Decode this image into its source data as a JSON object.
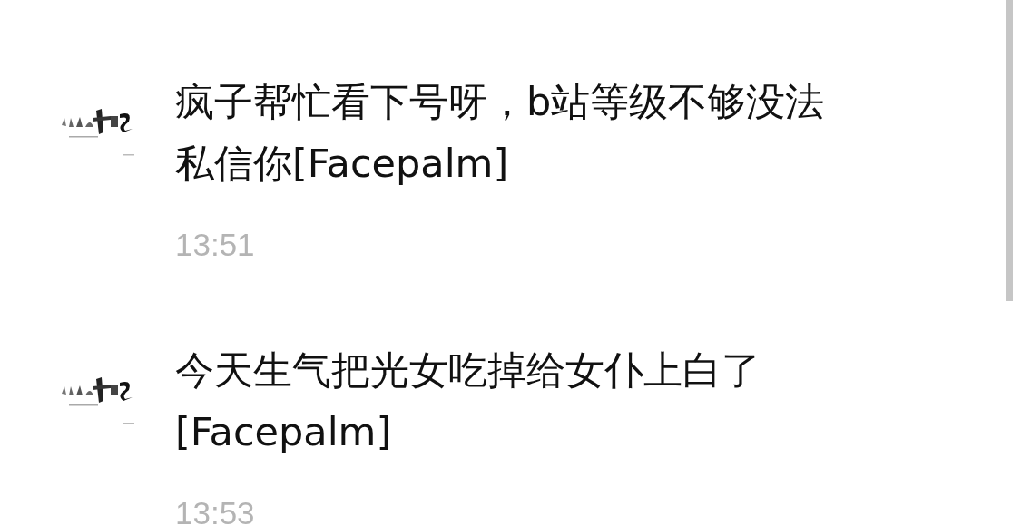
{
  "messages": [
    {
      "text": "疯子帮忙看下号呀，b站等级不够没法私信你[Facepalm]",
      "time": "13:51"
    },
    {
      "text": "今天生气把光女吃掉给女仆上白了[Facepalm]",
      "time": "13:53"
    }
  ]
}
